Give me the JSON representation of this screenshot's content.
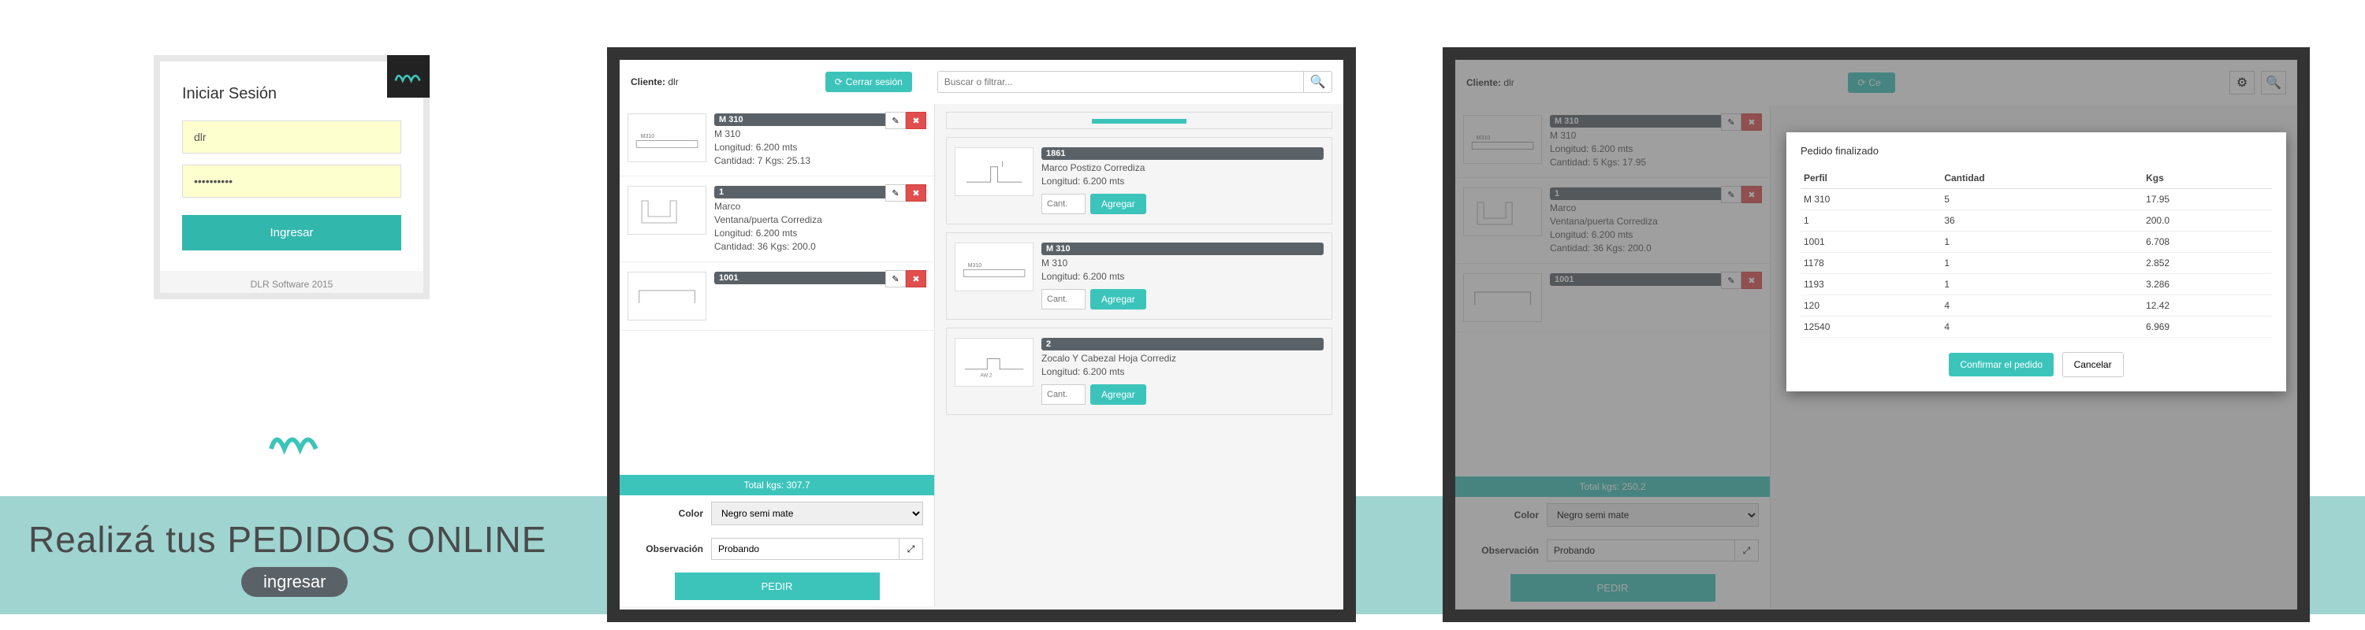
{
  "login": {
    "title": "Iniciar Sesión",
    "user_value": "dlr",
    "pass_value": "••••••••••",
    "submit": "Ingresar",
    "footer": "DLR Software 2015"
  },
  "banner": {
    "headline": "Realizá tus PEDIDOS ONLINE",
    "cta": "ingresar"
  },
  "app": {
    "client_label": "Cliente:",
    "client_value": "dlr",
    "logout": "Cerrar sesión",
    "search_placeholder": "Buscar o filtrar...",
    "color_label": "Color",
    "color_value": "Negro semi mate",
    "obs_label": "Observación",
    "obs_value": "Probando",
    "pedir": "PEDIR",
    "cant_ph": "Cant.",
    "agregar": "Agregar"
  },
  "panel2": {
    "total": "Total kgs: 307.7",
    "left": [
      {
        "badge": "M 310",
        "name": "M 310",
        "long": "Longitud: 6.200 mts",
        "cant": "Cantidad: 7 Kgs: 25.13"
      },
      {
        "badge": "1",
        "name": "Marco",
        "sub": "Ventana/puerta Corrediza",
        "long": "Longitud: 6.200 mts",
        "cant": "Cantidad: 36 Kgs: 200.0"
      },
      {
        "badge": "1001",
        "name": "",
        "long": "",
        "cant": ""
      }
    ],
    "right": [
      {
        "badge": "1861",
        "name": "Marco Postizo Corrediza",
        "long": "Longitud: 6.200 mts"
      },
      {
        "badge": "M 310",
        "name": "M 310",
        "long": "Longitud: 6.200 mts"
      },
      {
        "badge": "2",
        "name": "Zocalo Y Cabezal Hoja Corrediz",
        "long": "Longitud: 6.200 mts"
      }
    ]
  },
  "panel3": {
    "total": "Total kgs: 250.2",
    "left": [
      {
        "badge": "M 310",
        "name": "M 310",
        "long": "Longitud: 6.200 mts",
        "cant": "Cantidad: 5 Kgs: 17.95"
      },
      {
        "badge": "1",
        "name": "Marco",
        "sub": "Ventana/puerta Corrediza",
        "long": "Longitud: 6.200 mts",
        "cant": "Cantidad: 36 Kgs: 200.0"
      },
      {
        "badge": "1001",
        "name": "",
        "long": "",
        "cant": ""
      }
    ],
    "modal": {
      "title": "Pedido finalizado",
      "headers": [
        "Perfil",
        "Cantidad",
        "Kgs"
      ],
      "rows": [
        [
          "M 310",
          "5",
          "17.95"
        ],
        [
          "1",
          "36",
          "200.0"
        ],
        [
          "1001",
          "1",
          "6.708"
        ],
        [
          "1178",
          "1",
          "2.852"
        ],
        [
          "1193",
          "1",
          "3.286"
        ],
        [
          "120",
          "4",
          "12.42"
        ],
        [
          "12540",
          "4",
          "6.969"
        ]
      ],
      "confirm": "Confirmar el pedido",
      "cancel": "Cancelar"
    }
  }
}
